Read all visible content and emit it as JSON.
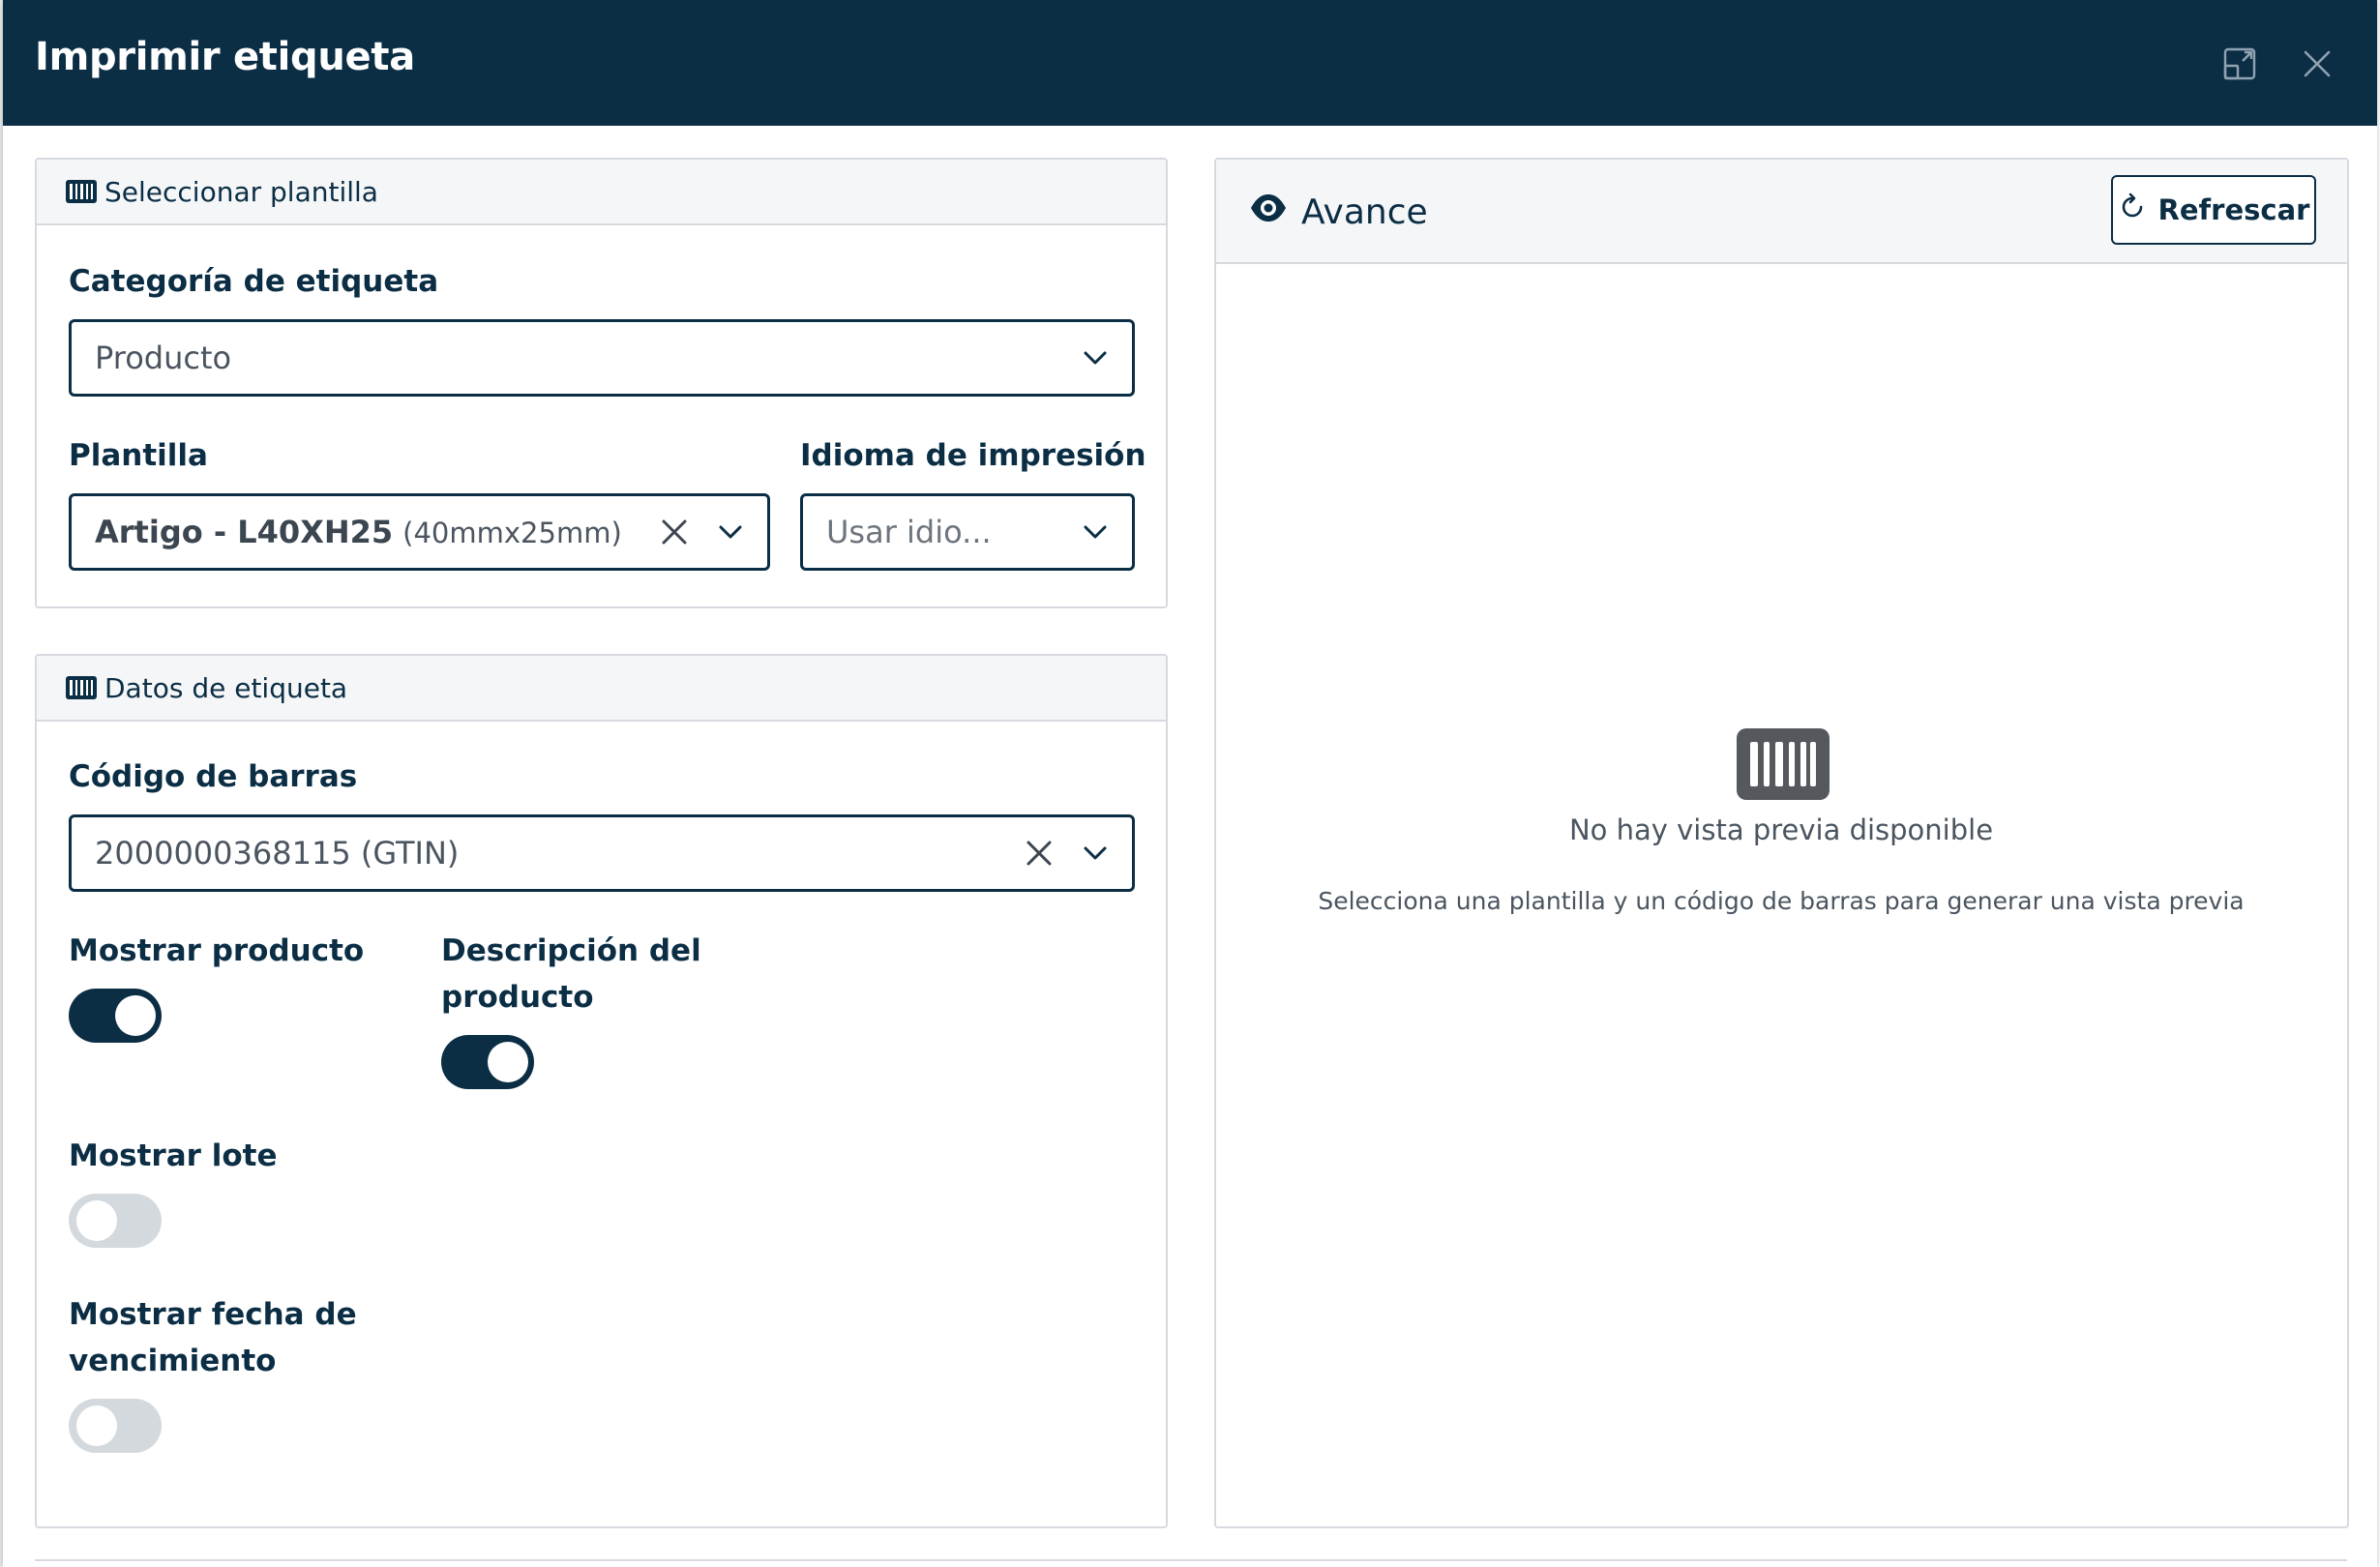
{
  "dialog": {
    "title": "Imprimir etiqueta"
  },
  "template_section": {
    "header": "Seleccionar plantilla",
    "category_label": "Categoría de etiqueta",
    "category_value": "Producto",
    "template_label": "Plantilla",
    "template_value": "Artigo - L40XH25",
    "template_size": "(40mmx25mm)",
    "language_label": "Idioma de impresión",
    "language_placeholder": "Usar idio..."
  },
  "data_section": {
    "header": "Datos de etiqueta",
    "barcode_label": "Código de barras",
    "barcode_value": "2000000368115 (GTIN)",
    "toggles": [
      {
        "label": "Mostrar producto",
        "on": true
      },
      {
        "label": "Descripción del producto",
        "on": true
      },
      {
        "label": "Mostrar lote",
        "on": false
      },
      {
        "label": "Mostrar fecha de vencimiento",
        "on": false
      }
    ]
  },
  "preview": {
    "title": "Avance",
    "refresh_label": "Refrescar",
    "empty_title": "No hay vista previa disponible",
    "empty_subtitle": "Selecciona una plantilla y un código de barras para generar una vista previa"
  },
  "colors": {
    "primary": "#0b2e45",
    "toggle_off": "#d4d9de",
    "panel_header": "#f5f6f7"
  },
  "icons": {
    "expand": "expand-icon",
    "close": "close-icon",
    "barcode": "barcode-icon",
    "eye": "eye-icon",
    "refresh": "refresh-icon",
    "chevron": "chevron-down-icon",
    "clear": "clear-icon"
  }
}
